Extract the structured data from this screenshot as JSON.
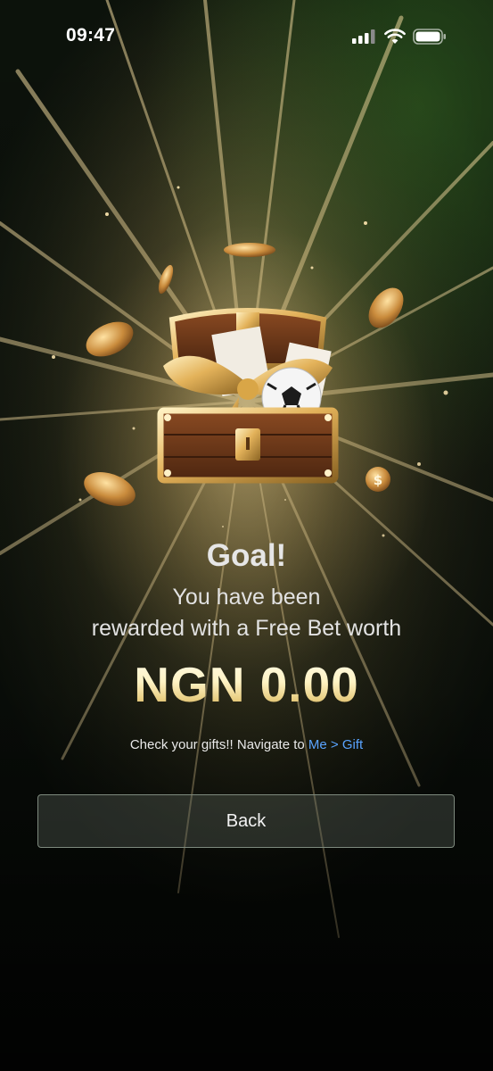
{
  "status_bar": {
    "time": "09:47",
    "icons": [
      "signal-icon",
      "wifi-icon",
      "battery-icon"
    ]
  },
  "reward": {
    "illustration": "treasure-chest-with-gift-and-football",
    "headline": "Goal!",
    "line1": "You have been",
    "line2": "rewarded with a Free Bet worth",
    "amount": "NGN 0.00",
    "hint_prefix": "Check your gifts!! Navigate to ",
    "hint_link": "Me > Gift"
  },
  "actions": {
    "back_label": "Back"
  },
  "colors": {
    "gold": "#e6c37a",
    "link": "#5aa4ff",
    "background": "#0c100b"
  }
}
